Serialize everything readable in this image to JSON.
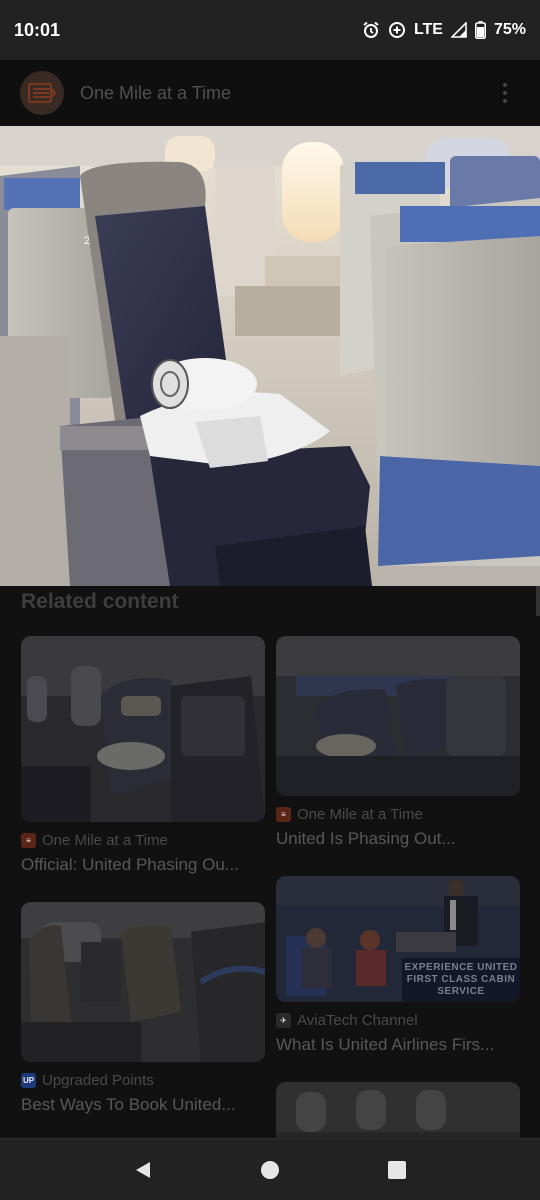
{
  "status": {
    "time": "10:01",
    "network": "LTE",
    "battery": "75%"
  },
  "header": {
    "source_name": "One Mile at a Time"
  },
  "related": {
    "heading": "Related content",
    "cards": [
      {
        "source": "One Mile at a Time",
        "title": "Official: United Phasing Ou..."
      },
      {
        "source": "One Mile at a Time",
        "title": "United Is Phasing Out..."
      },
      {
        "source": "Upgraded Points",
        "title": "Best Ways To Book United..."
      },
      {
        "source": "AviaTech Channel",
        "title": "What Is United Airlines Firs...",
        "caption": "EXPERIENCE UNITED FIRST CLASS CABIN SERVICE"
      }
    ]
  },
  "hero": {
    "seat_label": "2A"
  },
  "colors": {
    "accent": "#4a6fb0",
    "status_bar": "#222222"
  },
  "icons": [
    "alarm-icon",
    "data-saver-icon",
    "signal-icon",
    "battery-icon",
    "more-vert-icon",
    "back-icon",
    "home-icon",
    "recents-icon"
  ]
}
